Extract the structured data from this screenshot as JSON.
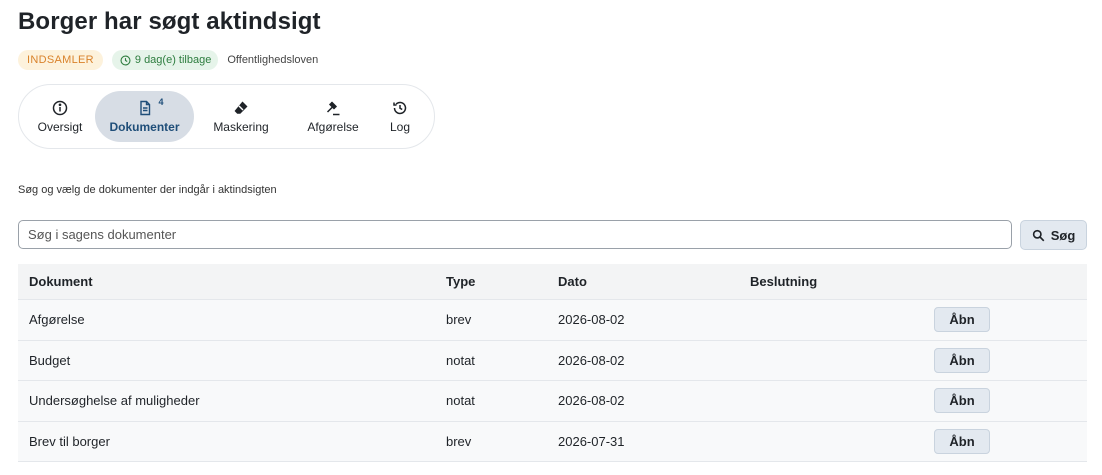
{
  "page": {
    "title": "Borger har søgt aktindsigt",
    "status_badge": "INDSAMLER",
    "deadline_badge": "9 dag(e) tilbage",
    "law": "Offentlighedsloven"
  },
  "tabs": [
    {
      "label": "Oversigt",
      "icon": "info-icon"
    },
    {
      "label": "Dokumenter",
      "icon": "document-icon",
      "count": "4",
      "active": true
    },
    {
      "label": "Maskering",
      "icon": "eraser-icon"
    },
    {
      "label": "Afgørelse",
      "icon": "gavel-icon"
    },
    {
      "label": "Log",
      "icon": "history-icon"
    }
  ],
  "documents": {
    "hint": "Søg og vælg de dokumenter der indgår i aktindsigten",
    "search_placeholder": "Søg i sagens dokumenter",
    "search_button": "Søg",
    "columns": [
      "Dokument",
      "Type",
      "Dato",
      "Beslutning"
    ],
    "rows": [
      {
        "name": "Afgørelse",
        "type": "brev",
        "date": "2026-08-02",
        "decision": "",
        "action": "Åbn"
      },
      {
        "name": "Budget",
        "type": "notat",
        "date": "2026-08-02",
        "decision": "",
        "action": "Åbn"
      },
      {
        "name": "Undersøghelse af muligheder",
        "type": "notat",
        "date": "2026-08-02",
        "decision": "",
        "action": "Åbn"
      },
      {
        "name": "Brev til borger",
        "type": "brev",
        "date": "2026-07-31",
        "decision": "",
        "action": "Åbn"
      }
    ]
  },
  "colors": {
    "status_bg": "#fdf2dc",
    "status_text": "#d9822b",
    "deadline_bg": "#e6f4ea",
    "deadline_text": "#2d7d3f",
    "active_tab_bg": "#d7dde5",
    "active_tab_text": "#1f4e79"
  }
}
